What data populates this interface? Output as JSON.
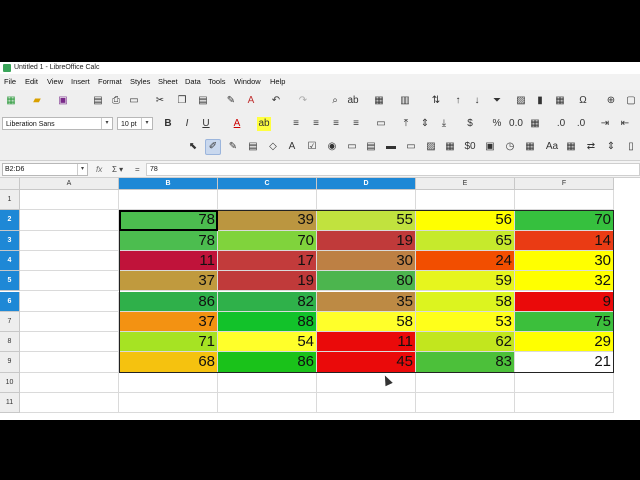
{
  "title": "Untitled 1 - LibreOffice Calc",
  "menu": [
    "File",
    "Edit",
    "View",
    "Insert",
    "Format",
    "Styles",
    "Sheet",
    "Data",
    "Tools",
    "Window",
    "Help"
  ],
  "font": {
    "name": "Liberation Sans",
    "size": "10 pt"
  },
  "namebox": "B2:D6",
  "formula": "78",
  "columns": [
    "A",
    "B",
    "C",
    "D",
    "E",
    "F"
  ],
  "rows": [
    "1",
    "2",
    "3",
    "4",
    "5",
    "6",
    "7",
    "8",
    "9",
    "10",
    "11"
  ],
  "cells": [
    [
      {
        "v": "78",
        "c": "#4cbd4f"
      },
      {
        "v": "39",
        "c": "#bb9640"
      },
      {
        "v": "55",
        "c": "#c1e23e"
      },
      {
        "v": "56",
        "c": "#ffff00"
      },
      {
        "v": "70",
        "c": "#36c03e"
      }
    ],
    [
      {
        "v": "78",
        "c": "#4cbd4f"
      },
      {
        "v": "70",
        "c": "#80d33c"
      },
      {
        "v": "19",
        "c": "#c03a3a"
      },
      {
        "v": "65",
        "c": "#c6ea2c"
      },
      {
        "v": "14",
        "c": "#ea3b14"
      }
    ],
    [
      {
        "v": "11",
        "c": "#c0133a"
      },
      {
        "v": "17",
        "c": "#c23b3b"
      },
      {
        "v": "30",
        "c": "#bd8044"
      },
      {
        "v": "24",
        "c": "#f24e00"
      },
      {
        "v": "30",
        "c": "#ffff00"
      }
    ],
    [
      {
        "v": "37",
        "c": "#c09a3e"
      },
      {
        "v": "19",
        "c": "#c03a3a"
      },
      {
        "v": "80",
        "c": "#4cb54e"
      },
      {
        "v": "59",
        "c": "#e6f51e"
      },
      {
        "v": "32",
        "c": "#ffff00"
      }
    ],
    [
      {
        "v": "86",
        "c": "#2fb04a"
      },
      {
        "v": "82",
        "c": "#2fb14a"
      },
      {
        "v": "35",
        "c": "#bd8a44"
      },
      {
        "v": "58",
        "c": "#dcf41f"
      },
      {
        "v": "9",
        "c": "#ea0a0a"
      }
    ],
    [
      {
        "v": "37",
        "c": "#f39212"
      },
      {
        "v": "88",
        "c": "#12c22a"
      },
      {
        "v": "58",
        "c": "#ffff2a"
      },
      {
        "v": "53",
        "c": "#ffff1a"
      },
      {
        "v": "75",
        "c": "#3cbf3c"
      }
    ],
    [
      {
        "v": "71",
        "c": "#a6e323"
      },
      {
        "v": "54",
        "c": "#ffff2a"
      },
      {
        "v": "11",
        "c": "#ea0a0a"
      },
      {
        "v": "62",
        "c": "#c2e61e"
      },
      {
        "v": "29",
        "c": "#ffff00"
      }
    ],
    [
      {
        "v": "68",
        "c": "#f5c20f"
      },
      {
        "v": "86",
        "c": "#1ac21a"
      },
      {
        "v": "45",
        "c": "#ea0a0a"
      },
      {
        "v": "83",
        "c": "#4cc03a"
      },
      {
        "v": "21",
        "c": "#ffffff"
      }
    ]
  ]
}
